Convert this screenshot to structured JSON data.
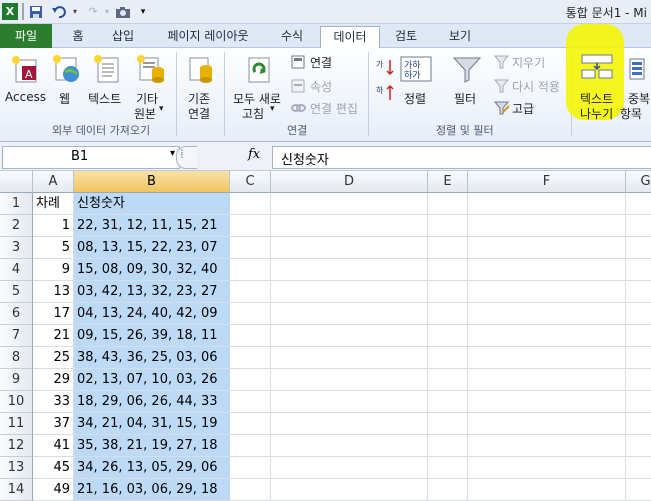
{
  "window": {
    "title": "통합 문서1 - Mi"
  },
  "tabs": [
    {
      "id": "file",
      "label": "파일"
    },
    {
      "id": "home",
      "label": "홈"
    },
    {
      "id": "insert",
      "label": "삽입"
    },
    {
      "id": "layout",
      "label": "페이지 레이아웃"
    },
    {
      "id": "formulas",
      "label": "수식"
    },
    {
      "id": "data",
      "label": "데이터"
    },
    {
      "id": "review",
      "label": "검토"
    },
    {
      "id": "view",
      "label": "보기"
    }
  ],
  "ribbon": {
    "access": "Access",
    "web": "웹",
    "text": "텍스트",
    "other_line1": "기타",
    "other_line2": "원본",
    "existing_line1": "기존",
    "existing_line2": "연결",
    "refresh_line1": "모두 새로",
    "refresh_line2": "고침",
    "connections": "연결",
    "properties": "속성",
    "edit_links": "연결 편집",
    "sort": "정렬",
    "filter": "필터",
    "clear": "지우기",
    "reapply": "다시 적용",
    "advanced": "고급",
    "text_to_columns_line1": "텍스트",
    "text_to_columns_line2": "나누기",
    "remove_dup_line1": "중복",
    "remove_dup_line2": "항목 ",
    "group_external": "외부 데이터 가져오기",
    "group_connections": "연결",
    "group_sortfilter": "정렬 및 필터",
    "highlight_color": "#f5f500"
  },
  "formula_bar": {
    "name_box": "B1",
    "fx": "fx",
    "content": "신청숫자"
  },
  "sheet": {
    "columns": [
      "A",
      "B",
      "C",
      "D",
      "E",
      "F",
      "G"
    ],
    "selected_column": "B",
    "rows": [
      {
        "n": "1",
        "a": "차례",
        "b": "신청숫자"
      },
      {
        "n": "2",
        "a": "1",
        "b": "22, 31, 12, 11, 15, 21"
      },
      {
        "n": "3",
        "a": "5",
        "b": "08, 13, 15, 22, 23, 07"
      },
      {
        "n": "4",
        "a": "9",
        "b": "15, 08, 09, 30, 32, 40"
      },
      {
        "n": "5",
        "a": "13",
        "b": "03, 42, 13, 32, 23, 27"
      },
      {
        "n": "6",
        "a": "17",
        "b": "04, 13, 24, 40, 42, 09"
      },
      {
        "n": "7",
        "a": "21",
        "b": "09, 15, 26, 39, 18, 11"
      },
      {
        "n": "8",
        "a": "25",
        "b": "38, 43, 36, 25, 03, 06"
      },
      {
        "n": "9",
        "a": "29",
        "b": "02, 13, 07, 10, 03, 26"
      },
      {
        "n": "10",
        "a": "33",
        "b": "18, 29, 06, 26, 44, 33"
      },
      {
        "n": "11",
        "a": "37",
        "b": "34, 21, 04, 31, 15, 19"
      },
      {
        "n": "12",
        "a": "41",
        "b": "35, 38, 21, 19, 27, 18"
      },
      {
        "n": "13",
        "a": "45",
        "b": "34, 26, 13, 05, 29, 06"
      },
      {
        "n": "14",
        "a": "49",
        "b": "21, 16, 03, 06, 29, 18"
      }
    ]
  }
}
